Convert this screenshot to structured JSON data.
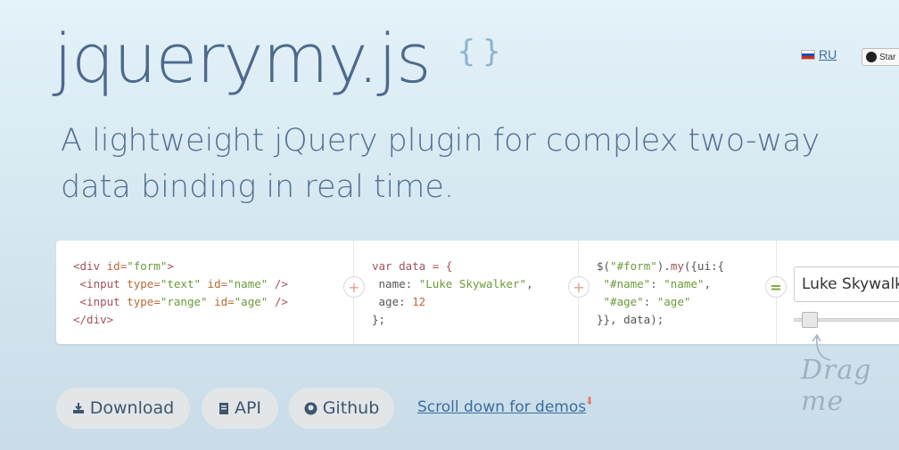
{
  "header": {
    "logo": "jquerymy.js",
    "braces_icon": "{ }",
    "lang_link": "RU",
    "star_button": "Star"
  },
  "tagline": "A lightweight jQuery plugin for complex two-way data binding in real time.",
  "panel": {
    "html_code": {
      "line1_tag_open": "<div ",
      "line1_attr": "id=",
      "line1_val": "\"form\"",
      "line1_close": ">",
      "line2_tag": " <input ",
      "line2_attr1": "type=",
      "line2_val1": "\"text\"",
      "line2_attr2": " id=",
      "line2_val2": "\"name\"",
      "line2_close": " />",
      "line3_tag": " <input ",
      "line3_attr1": "type=",
      "line3_val1": "\"range\"",
      "line3_attr2": " id=",
      "line3_val2": "\"age\"",
      "line3_close": " />",
      "line4": "</div>"
    },
    "data_code": {
      "line1": "var data = {",
      "line2_key": " name: ",
      "line2_val": "\"Luke Skywalker\"",
      "line2_end": ",",
      "line3_key": " age: ",
      "line3_val": "12",
      "line4": "};"
    },
    "bind_code": {
      "line1_a": "$(",
      "line1_b": "\"#form\"",
      "line1_c": ").",
      "line1_d": "my",
      "line1_e": "({ui:{",
      "line2_a": " \"#name\"",
      "line2_b": ": ",
      "line2_c": "\"name\"",
      "line2_d": ",",
      "line3_a": " \"#age\"",
      "line3_b": ": ",
      "line3_c": "\"age\"",
      "line4": "}}, data);"
    },
    "plus_symbol": "+",
    "equals_symbol": "=",
    "demo_input_value": "Luke Skywalker",
    "age_slider_value": 12,
    "drag_hint": "Drag me"
  },
  "actions": {
    "download_label": "Download",
    "api_label": "API",
    "github_label": "Github",
    "scroll_link": "Scroll down for demos",
    "scroll_arrow": "⬇"
  },
  "colors": {
    "logo": "#4d6a8c",
    "link": "#3a6e9e",
    "code_tag": "#a3525a",
    "code_string": "#6a9a3a"
  }
}
